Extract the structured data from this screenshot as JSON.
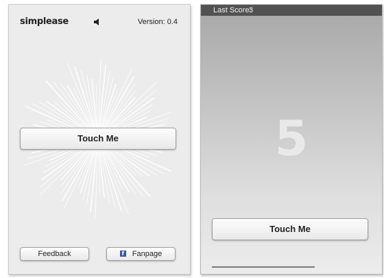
{
  "left_screen": {
    "brand": "simplease",
    "speaker_icon": "speaker-icon",
    "version": "Version: 0.4",
    "touch_button": "Touch Me",
    "feedback_button": "Feedback",
    "fanpage_button": "Fanpage",
    "facebook_icon": "facebook-icon"
  },
  "right_screen": {
    "last_score_label": "Last Score:",
    "last_score_value": "3",
    "countdown": "5",
    "touch_button": "Touch Me",
    "progress": 1.0
  },
  "colors": {
    "status_bar": "#525252",
    "facebook_blue": "#3b5998",
    "countdown_text": "#e9e9e9"
  }
}
